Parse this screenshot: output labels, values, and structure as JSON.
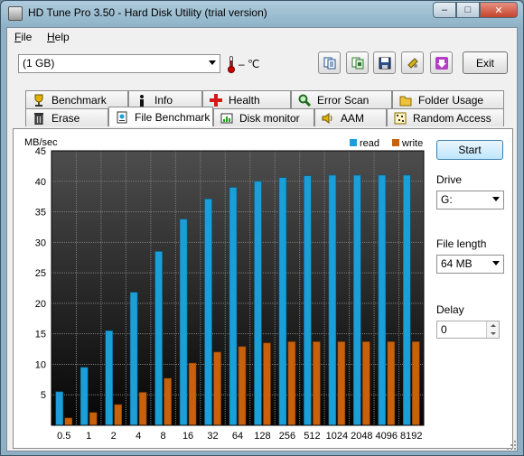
{
  "window": {
    "title": "HD Tune Pro 3.50 - Hard Disk Utility (trial version)",
    "minimize_glyph": "–",
    "maximize_glyph": "□",
    "close_glyph": "✕"
  },
  "menu": [
    {
      "label": "File",
      "accel": "F",
      "rest": "ile"
    },
    {
      "label": "Help",
      "accel": "H",
      "rest": "elp"
    }
  ],
  "toolbar": {
    "drive": "(1 GB)",
    "temperature": "– ℃",
    "exit_label": "Exit",
    "icons": [
      "copy-info-icon",
      "copy-screenshot-icon",
      "save-icon",
      "options-icon",
      "down-arrow-icon"
    ]
  },
  "tabs": {
    "row1": [
      {
        "label": "Benchmark",
        "icon": "trophy-icon"
      },
      {
        "label": "Info",
        "icon": "info-icon"
      },
      {
        "label": "Health",
        "icon": "health-cross-icon"
      },
      {
        "label": "Error Scan",
        "icon": "magnifier-icon"
      },
      {
        "label": "Folder Usage",
        "icon": "folder-icon"
      }
    ],
    "row2": [
      {
        "label": "Erase",
        "icon": "trash-icon"
      },
      {
        "label": "File Benchmark",
        "icon": "file-benchmark-icon",
        "active": true
      },
      {
        "label": "Disk monitor",
        "icon": "monitor-icon"
      },
      {
        "label": "AAM",
        "icon": "speaker-icon"
      },
      {
        "label": "Random Access",
        "icon": "random-access-icon"
      }
    ]
  },
  "controls": {
    "start_label": "Start",
    "drive_label": "Drive",
    "drive_value": "G:",
    "file_length_label": "File length",
    "file_length_value": "64 MB",
    "delay_label": "Delay",
    "delay_value": "0"
  },
  "colors": {
    "read": "#1a9fd8",
    "write": "#c8600c",
    "plot_bg_top": "#4d4d4d",
    "plot_bg_bottom": "#050505"
  },
  "chart_data": {
    "type": "bar",
    "ylabel": "MB/sec",
    "ylim": [
      0,
      45
    ],
    "yticks": [
      5,
      10,
      15,
      20,
      25,
      30,
      35,
      40,
      45
    ],
    "categories": [
      "0.5",
      "1",
      "2",
      "4",
      "8",
      "16",
      "32",
      "64",
      "128",
      "256",
      "512",
      "1024",
      "2048",
      "4096",
      "8192"
    ],
    "series": [
      {
        "name": "read",
        "values": [
          5.5,
          9.5,
          15.5,
          21.8,
          28.5,
          33.8,
          37.1,
          39.0,
          40.0,
          40.6,
          40.9,
          41.0,
          41.0,
          41.0,
          41.0
        ]
      },
      {
        "name": "write",
        "values": [
          1.2,
          2.1,
          3.4,
          5.4,
          7.7,
          10.2,
          12.0,
          12.9,
          13.5,
          13.7,
          13.7,
          13.7,
          13.7,
          13.7,
          13.7
        ]
      }
    ],
    "legend_position": "top-right",
    "grid": true
  }
}
